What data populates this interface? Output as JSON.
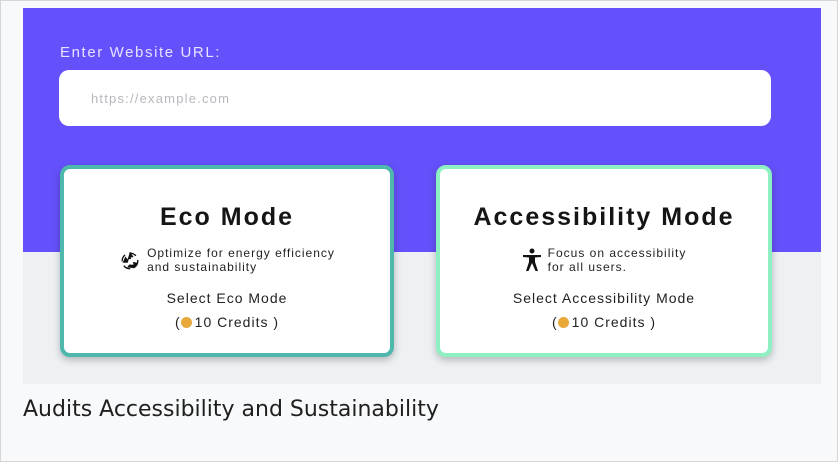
{
  "url_section": {
    "label": "Enter Website URL:",
    "placeholder": "https://example.com"
  },
  "cards": {
    "eco": {
      "title": "Eco Mode",
      "desc_line1": "Optimize for energy efficiency",
      "desc_line2": "and sustainability",
      "icon": "recycle-icon",
      "select_label": "Select Eco Mode",
      "credits_open": "(",
      "credits_text": "10 Credits )"
    },
    "accessibility": {
      "title": "Accessibility Mode",
      "desc_line1": "Focus on accessibility",
      "desc_line2": "for all users.",
      "icon": "accessibility-person-icon",
      "select_label": "Select Accessibility Mode",
      "credits_open": "(",
      "credits_text": "10 Credits )"
    }
  },
  "caption": "Audits Accessibility and Sustainability",
  "colors": {
    "hero": "#6551fb",
    "eco_border": "#4fb8ad",
    "access_border": "#8ef0c2",
    "coin": "#e8a83a"
  }
}
